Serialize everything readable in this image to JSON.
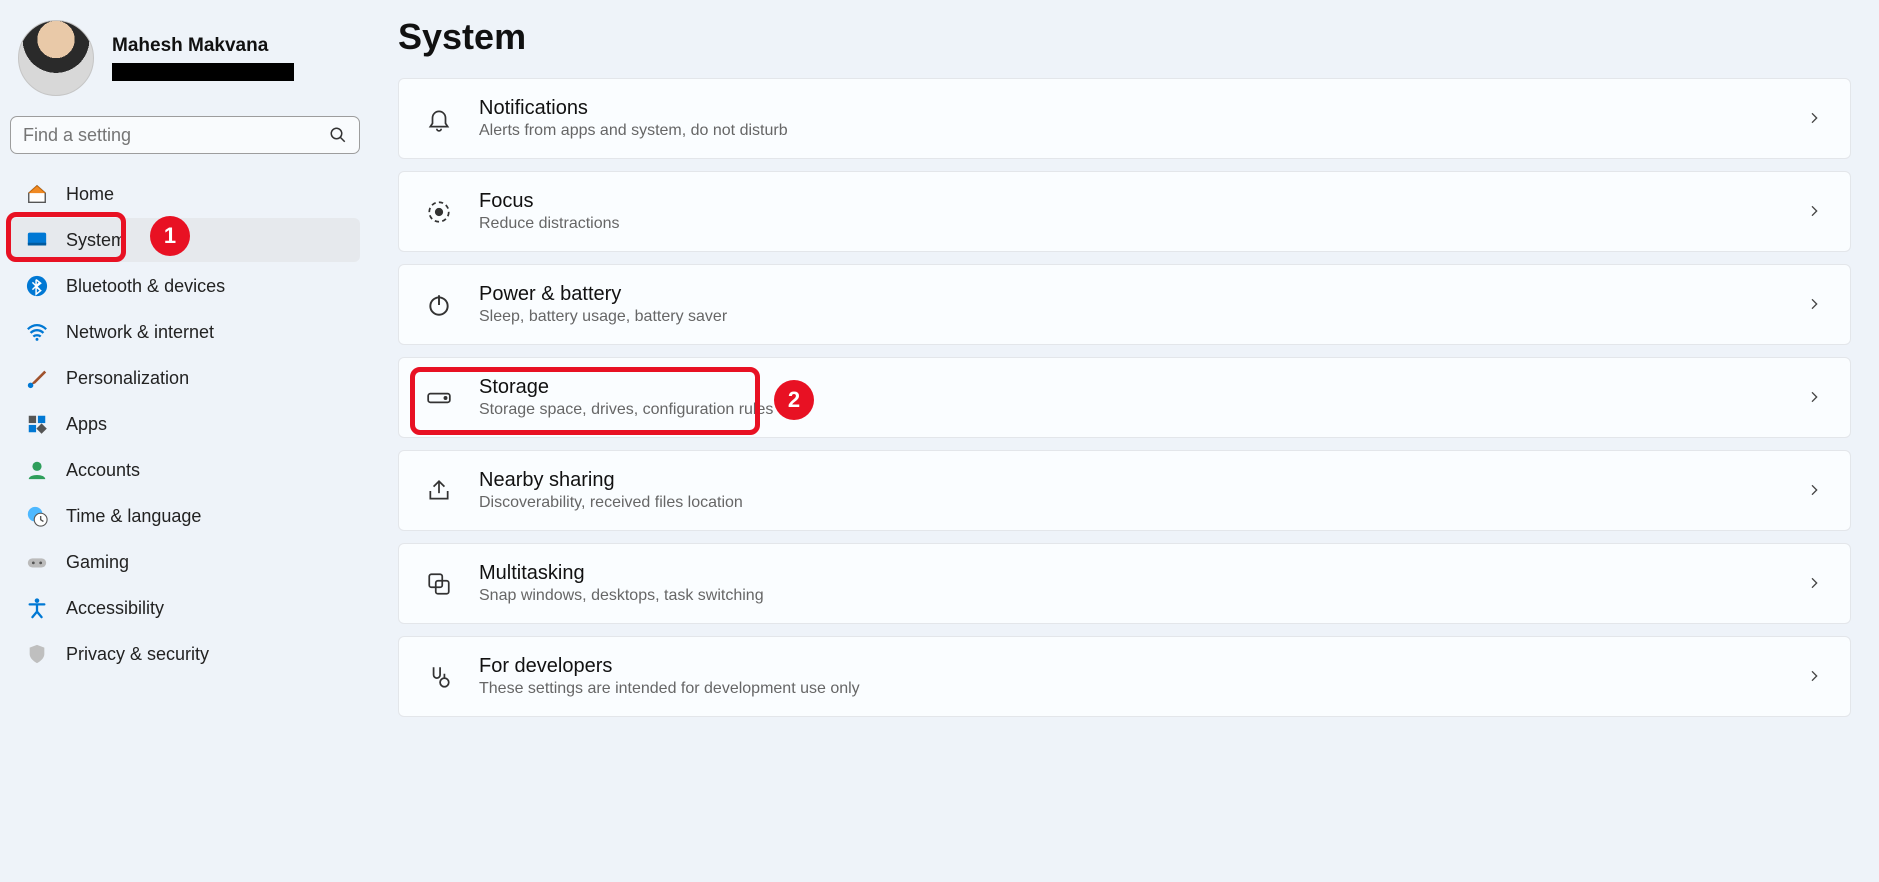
{
  "profile": {
    "name": "Mahesh Makvana"
  },
  "search": {
    "placeholder": "Find a setting"
  },
  "nav": [
    {
      "key": "home",
      "label": "Home"
    },
    {
      "key": "system",
      "label": "System",
      "selected": true,
      "annot": 1
    },
    {
      "key": "bluetooth",
      "label": "Bluetooth & devices"
    },
    {
      "key": "network",
      "label": "Network & internet"
    },
    {
      "key": "personalization",
      "label": "Personalization"
    },
    {
      "key": "apps",
      "label": "Apps"
    },
    {
      "key": "accounts",
      "label": "Accounts"
    },
    {
      "key": "time",
      "label": "Time & language"
    },
    {
      "key": "gaming",
      "label": "Gaming"
    },
    {
      "key": "accessibility",
      "label": "Accessibility"
    },
    {
      "key": "privacy",
      "label": "Privacy & security"
    }
  ],
  "page": {
    "title": "System"
  },
  "cards": [
    {
      "key": "notifications",
      "title": "Notifications",
      "sub": "Alerts from apps and system, do not disturb"
    },
    {
      "key": "focus",
      "title": "Focus",
      "sub": "Reduce distractions"
    },
    {
      "key": "power",
      "title": "Power & battery",
      "sub": "Sleep, battery usage, battery saver"
    },
    {
      "key": "storage",
      "title": "Storage",
      "sub": "Storage space, drives, configuration rules",
      "annot": 2
    },
    {
      "key": "nearby",
      "title": "Nearby sharing",
      "sub": "Discoverability, received files location"
    },
    {
      "key": "multitasking",
      "title": "Multitasking",
      "sub": "Snap windows, desktops, task switching"
    },
    {
      "key": "developers",
      "title": "For developers",
      "sub": "These settings are intended for development use only"
    }
  ],
  "annotations": {
    "1": "1",
    "2": "2"
  }
}
